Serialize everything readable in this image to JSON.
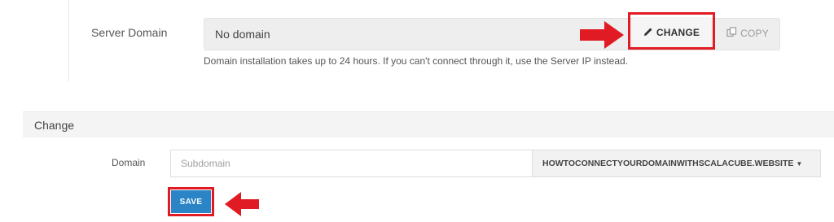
{
  "server_domain": {
    "label": "Server Domain",
    "value": "No domain",
    "change_button": "CHANGE",
    "copy_button": "COPY",
    "help_text": "Domain installation takes up to 24 hours. If you can't connect through it, use the Server IP instead."
  },
  "change_panel": {
    "title": "Change",
    "domain_label": "Domain",
    "subdomain_placeholder": "Subdomain",
    "subdomain_value": "",
    "domain_select_value": "HOWTOCONNECTYOURDOMAINWITHSCALACUBE.WEBSITE",
    "save_button": "SAVE"
  },
  "icons": {
    "change_icon": "pencil-icon",
    "copy_icon": "copy-icon",
    "select_icon": "caret-down-icon",
    "annotation_icon": "arrow-right-icon"
  },
  "colors": {
    "highlight": "#e01b24",
    "save_button_bg": "#2a84c6",
    "arrow": "#e01b24"
  }
}
